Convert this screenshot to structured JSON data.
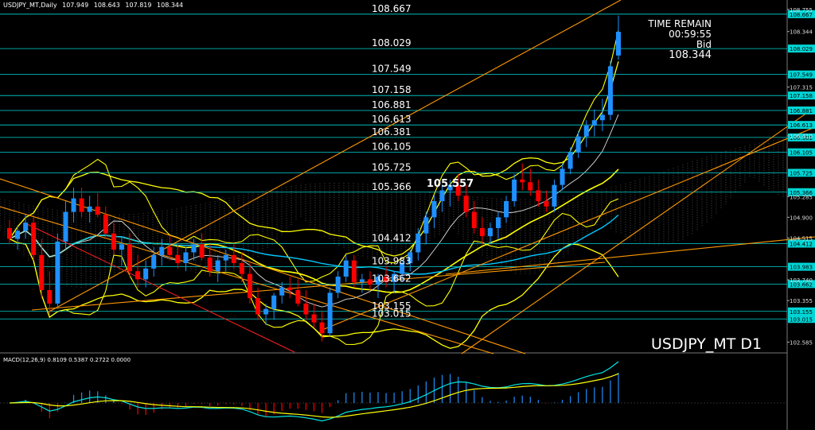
{
  "header": {
    "symbol_tf": "USDJPY_MT,Daily",
    "open": "107.949",
    "high": "108.643",
    "low": "107.819",
    "close": "108.344"
  },
  "info_panel": {
    "label_time": "TIME REMAIN",
    "time_value": "00:59:55",
    "label_bid": "Bid",
    "bid_value": "108.344"
  },
  "symbol_label": {
    "symbol": "USDJPY_MT",
    "timeframe": "D1"
  },
  "macd_header": "MACD(12,26,9) 0.8109 0.5387 0.2722 0.0000",
  "colors": {
    "background": "#000000",
    "bull_candle": "#1e90ff",
    "bear_candle": "#ff0000",
    "level_line": "#00d5d5",
    "bollinger": "#ffff00",
    "channel": "#ff9900",
    "ma_cyan": "#00c8ff",
    "macd_line": "#00e5e5",
    "signal_line": "#ffff00",
    "price_tag_bg": "#00d5d5"
  },
  "chart_data": {
    "type": "candlestick",
    "symbol": "USDJPY_MT",
    "timeframe": "D1",
    "ylim": [
      102.4,
      108.9
    ],
    "horizontal_levels": [
      {
        "value": 108.667,
        "label": "108.667"
      },
      {
        "value": 108.029,
        "label": "108.029"
      },
      {
        "value": 107.549,
        "label": "107.549"
      },
      {
        "value": 107.158,
        "label": "107.158"
      },
      {
        "value": 106.881,
        "label": "106.881"
      },
      {
        "value": 106.613,
        "label": "106.613"
      },
      {
        "value": 106.381,
        "label": "106.381"
      },
      {
        "value": 106.105,
        "label": "106.105"
      },
      {
        "value": 105.725,
        "label": "105.725"
      },
      {
        "value": 105.366,
        "label": "105.366"
      },
      {
        "value": 104.412,
        "label": "104.412"
      },
      {
        "value": 103.983,
        "label": "103.983"
      },
      {
        "value": 103.662,
        "label": "103.662"
      },
      {
        "value": 103.155,
        "label": "103.155"
      },
      {
        "value": 103.015,
        "label": "103.015"
      }
    ],
    "annotation": {
      "value": 105.557,
      "label": "105.557"
    },
    "y_ticks": [
      {
        "value": 108.755,
        "label": "108.755"
      },
      {
        "value": 108.344,
        "label": "108.344"
      },
      {
        "value": 107.315,
        "label": "107.315"
      },
      {
        "value": 106.41,
        "label": "106.410"
      },
      {
        "value": 105.285,
        "label": "105.285"
      },
      {
        "value": 104.9,
        "label": "104.900"
      },
      {
        "value": 104.515,
        "label": "104.515"
      },
      {
        "value": 103.74,
        "label": "103.740"
      },
      {
        "value": 103.355,
        "label": "103.355"
      },
      {
        "value": 102.585,
        "label": "102.585"
      }
    ],
    "candles": [
      [
        104.7,
        104.85,
        104.4,
        104.5
      ],
      [
        104.5,
        104.75,
        104.3,
        104.65
      ],
      [
        104.65,
        104.95,
        104.5,
        104.8
      ],
      [
        104.8,
        104.9,
        104.1,
        104.2
      ],
      [
        104.2,
        104.5,
        103.4,
        103.55
      ],
      [
        103.55,
        103.9,
        103.1,
        103.3
      ],
      [
        103.3,
        104.6,
        103.2,
        104.45
      ],
      [
        104.45,
        105.2,
        104.3,
        105.0
      ],
      [
        105.0,
        105.45,
        104.8,
        105.25
      ],
      [
        105.25,
        105.45,
        104.9,
        105.0
      ],
      [
        105.0,
        105.3,
        104.8,
        105.1
      ],
      [
        105.1,
        105.35,
        104.9,
        104.95
      ],
      [
        104.95,
        105.1,
        104.5,
        104.6
      ],
      [
        104.6,
        104.8,
        104.2,
        104.3
      ],
      [
        104.3,
        104.55,
        104.0,
        104.4
      ],
      [
        104.4,
        104.6,
        103.8,
        103.9
      ],
      [
        103.9,
        104.2,
        103.6,
        103.75
      ],
      [
        103.75,
        104.1,
        103.6,
        103.95
      ],
      [
        103.95,
        104.35,
        103.8,
        104.2
      ],
      [
        104.2,
        104.5,
        104.0,
        104.35
      ],
      [
        104.35,
        104.55,
        104.1,
        104.2
      ],
      [
        104.2,
        104.4,
        103.95,
        104.05
      ],
      [
        104.05,
        104.35,
        103.9,
        104.25
      ],
      [
        104.25,
        104.5,
        104.1,
        104.4
      ],
      [
        104.4,
        104.6,
        104.1,
        104.15
      ],
      [
        104.15,
        104.4,
        103.8,
        103.9
      ],
      [
        103.9,
        104.2,
        103.7,
        104.1
      ],
      [
        104.1,
        104.3,
        103.9,
        104.2
      ],
      [
        104.2,
        104.4,
        103.95,
        104.05
      ],
      [
        104.05,
        104.25,
        103.7,
        103.85
      ],
      [
        103.85,
        104.05,
        103.3,
        103.4
      ],
      [
        103.4,
        103.6,
        103.0,
        103.1
      ],
      [
        103.1,
        103.3,
        102.9,
        103.2
      ],
      [
        103.2,
        103.5,
        103.0,
        103.45
      ],
      [
        103.45,
        103.7,
        103.3,
        103.6
      ],
      [
        103.6,
        103.8,
        103.4,
        103.55
      ],
      [
        103.55,
        103.75,
        103.25,
        103.3
      ],
      [
        103.3,
        103.55,
        103.0,
        103.1
      ],
      [
        103.1,
        103.3,
        102.85,
        102.95
      ],
      [
        102.95,
        103.15,
        102.6,
        102.75
      ],
      [
        102.75,
        103.6,
        102.7,
        103.5
      ],
      [
        103.5,
        103.9,
        103.4,
        103.8
      ],
      [
        103.8,
        104.2,
        103.7,
        104.1
      ],
      [
        104.1,
        104.2,
        103.6,
        103.7
      ],
      [
        103.7,
        103.85,
        103.5,
        103.75
      ],
      [
        103.75,
        103.9,
        103.55,
        103.65
      ],
      [
        103.65,
        103.85,
        103.4,
        103.8
      ],
      [
        103.8,
        104.0,
        103.6,
        103.7
      ],
      [
        103.7,
        103.9,
        103.5,
        103.85
      ],
      [
        103.85,
        104.1,
        103.7,
        104.05
      ],
      [
        104.05,
        104.3,
        103.9,
        104.25
      ],
      [
        104.25,
        104.7,
        104.1,
        104.6
      ],
      [
        104.6,
        105.0,
        104.4,
        104.9
      ],
      [
        104.9,
        105.3,
        104.7,
        105.2
      ],
      [
        105.2,
        105.5,
        105.0,
        105.4
      ],
      [
        105.4,
        105.6,
        105.1,
        105.5
      ],
      [
        105.5,
        105.7,
        105.2,
        105.3
      ],
      [
        105.3,
        105.5,
        104.9,
        105.0
      ],
      [
        105.0,
        105.2,
        104.6,
        104.7
      ],
      [
        104.7,
        104.9,
        104.4,
        104.55
      ],
      [
        104.55,
        104.8,
        104.4,
        104.7
      ],
      [
        104.7,
        105.0,
        104.5,
        104.9
      ],
      [
        104.9,
        105.3,
        104.8,
        105.2
      ],
      [
        105.2,
        105.7,
        105.1,
        105.6
      ],
      [
        105.6,
        105.9,
        105.4,
        105.55
      ],
      [
        105.55,
        105.8,
        105.3,
        105.4
      ],
      [
        105.4,
        105.6,
        105.1,
        105.2
      ],
      [
        105.2,
        105.4,
        105.0,
        105.1
      ],
      [
        105.1,
        105.6,
        105.0,
        105.5
      ],
      [
        105.5,
        105.9,
        105.4,
        105.8
      ],
      [
        105.8,
        106.2,
        105.7,
        106.1
      ],
      [
        106.1,
        106.5,
        106.0,
        106.4
      ],
      [
        106.4,
        106.7,
        106.2,
        106.6
      ],
      [
        106.6,
        106.9,
        106.4,
        106.7
      ],
      [
        106.7,
        107.1,
        106.5,
        106.8
      ],
      [
        106.8,
        107.8,
        106.7,
        107.7
      ],
      [
        107.9,
        108.64,
        107.82,
        108.34
      ]
    ]
  }
}
